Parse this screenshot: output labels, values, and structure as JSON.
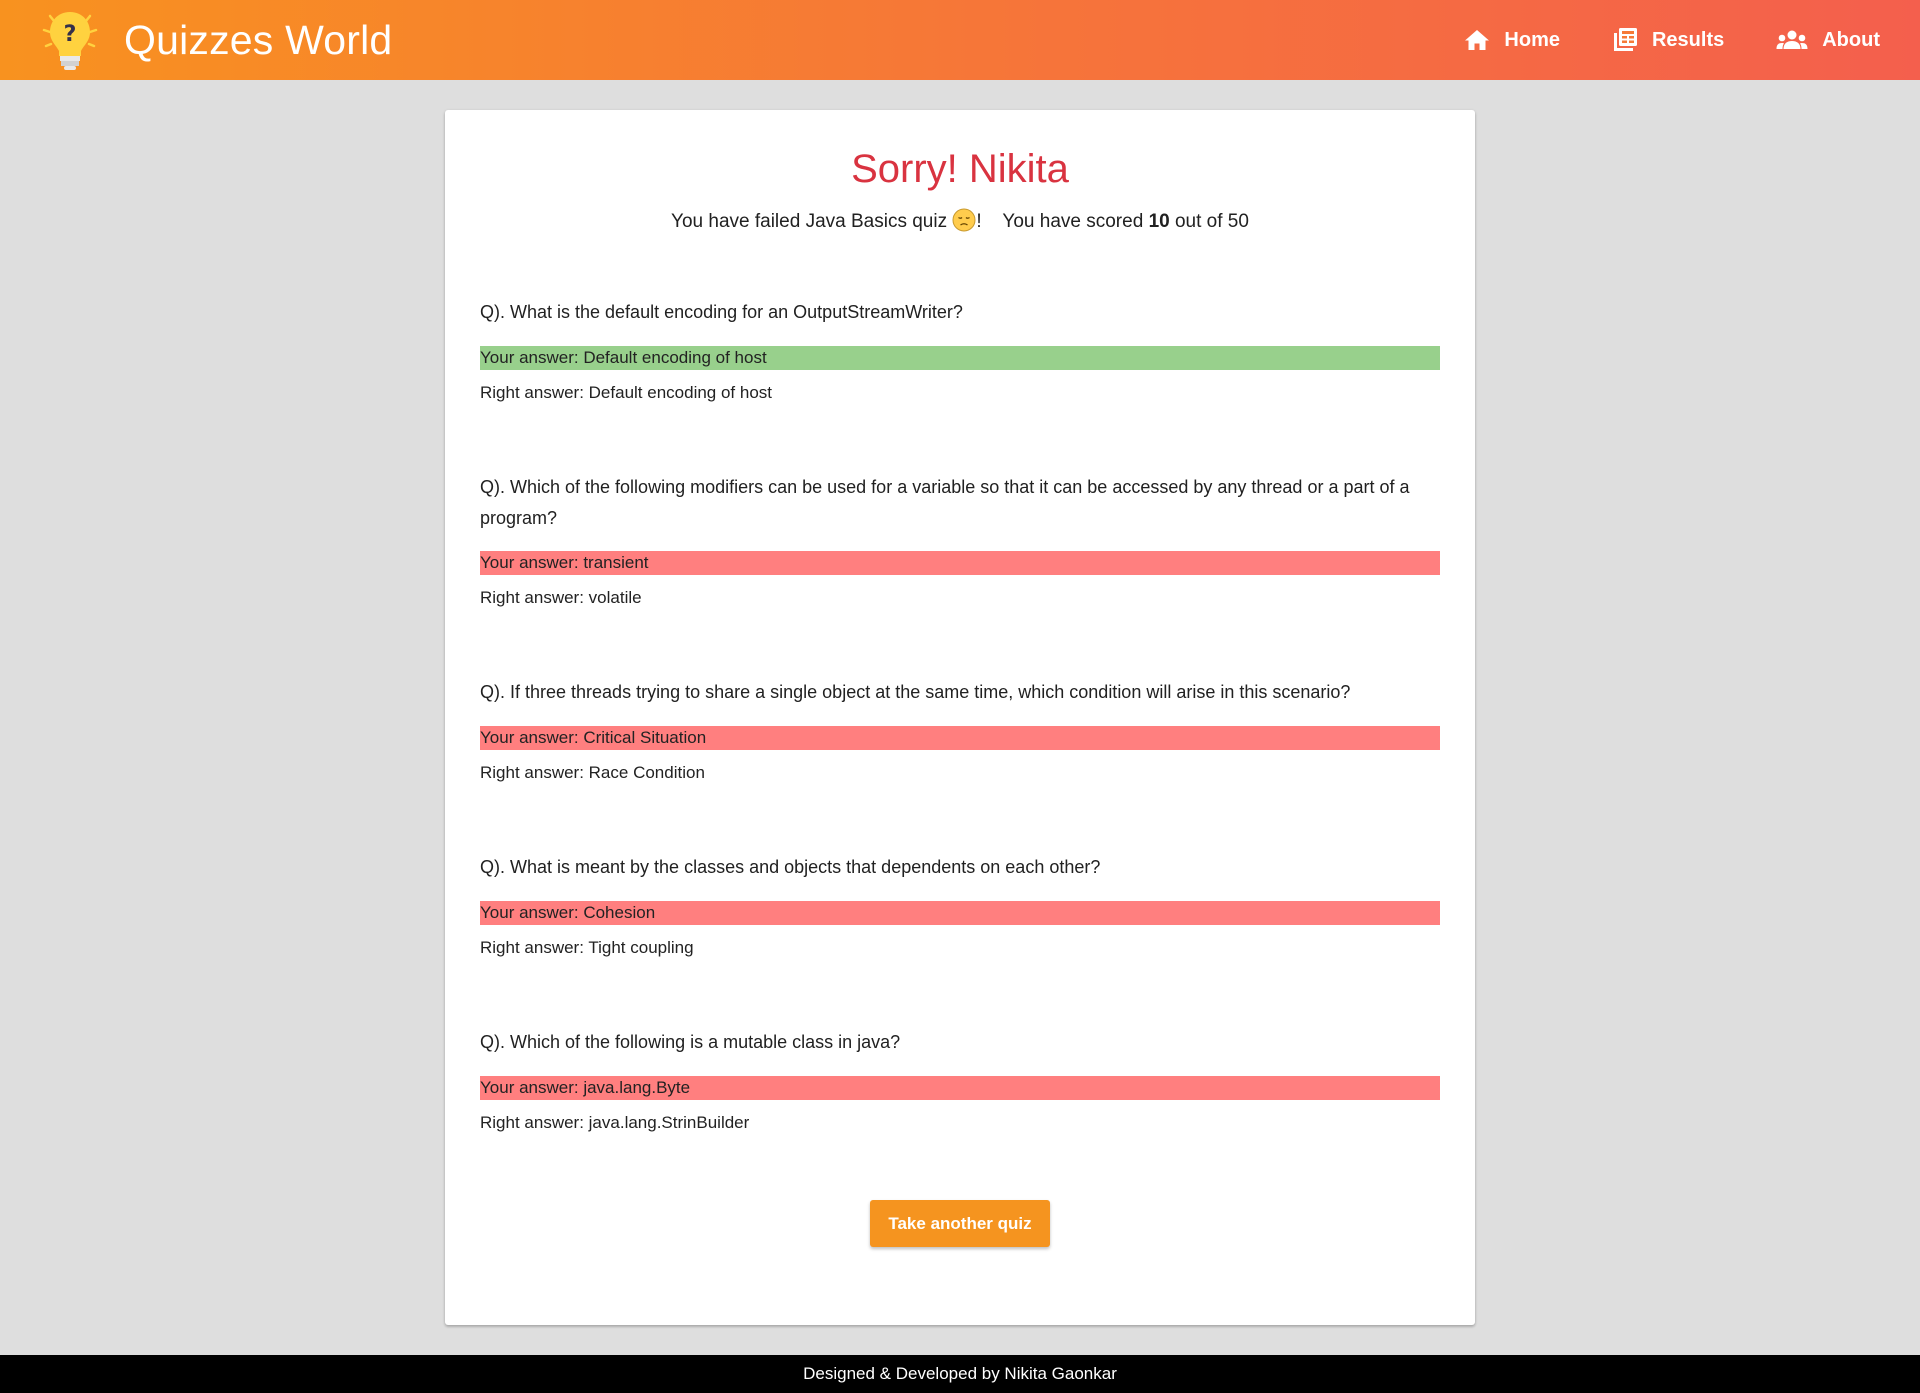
{
  "header": {
    "brand_title": "Quizzes World",
    "logo_icon": "lightbulb-question-icon",
    "nav": [
      {
        "label": "Home",
        "icon": "home-icon"
      },
      {
        "label": "Results",
        "icon": "newspaper-icon"
      },
      {
        "label": "About",
        "icon": "group-icon"
      }
    ],
    "gradient_colors": [
      "#f8921f",
      "#f45f4d"
    ]
  },
  "result": {
    "title": "Sorry! Nikita",
    "sub_prefix": "You have failed Java Basics quiz",
    "sub_after_emoji": "!",
    "score_prefix": "You have scored",
    "score": "10",
    "score_suffix": "out of 50",
    "title_color": "#d93340"
  },
  "questions": [
    {
      "question": "Q). What is the default encoding for an OutputStreamWriter?",
      "your_answer": "Your answer: Default encoding of host",
      "right_answer": "Right answer: Default encoding of host",
      "correct": true
    },
    {
      "question": "Q). Which of the following modifiers can be used for a variable so that it can be accessed by any thread or a part of a program?",
      "your_answer": "Your answer: transient",
      "right_answer": "Right answer: volatile",
      "correct": false
    },
    {
      "question": "Q). If three threads trying to share a single object at the same time, which condition will arise in this scenario?",
      "your_answer": "Your answer: Critical Situation",
      "right_answer": "Right answer: Race Condition",
      "correct": false
    },
    {
      "question": "Q). What is meant by the classes and objects that dependents on each other?",
      "your_answer": "Your answer: Cohesion",
      "right_answer": "Right answer: Tight coupling",
      "correct": false
    },
    {
      "question": "Q). Which of the following is a mutable class in java?",
      "your_answer": "Your answer: java.lang.Byte",
      "right_answer": "Right answer: java.lang.StrinBuilder",
      "correct": false
    }
  ],
  "actions": {
    "take_another_label": "Take another quiz"
  },
  "footer": {
    "text": "Designed & Developed by Nikita Gaonkar"
  },
  "colors": {
    "correct_bg": "#98d08c",
    "wrong_bg": "#ff7f7f",
    "button_bg": "#f5941f"
  }
}
